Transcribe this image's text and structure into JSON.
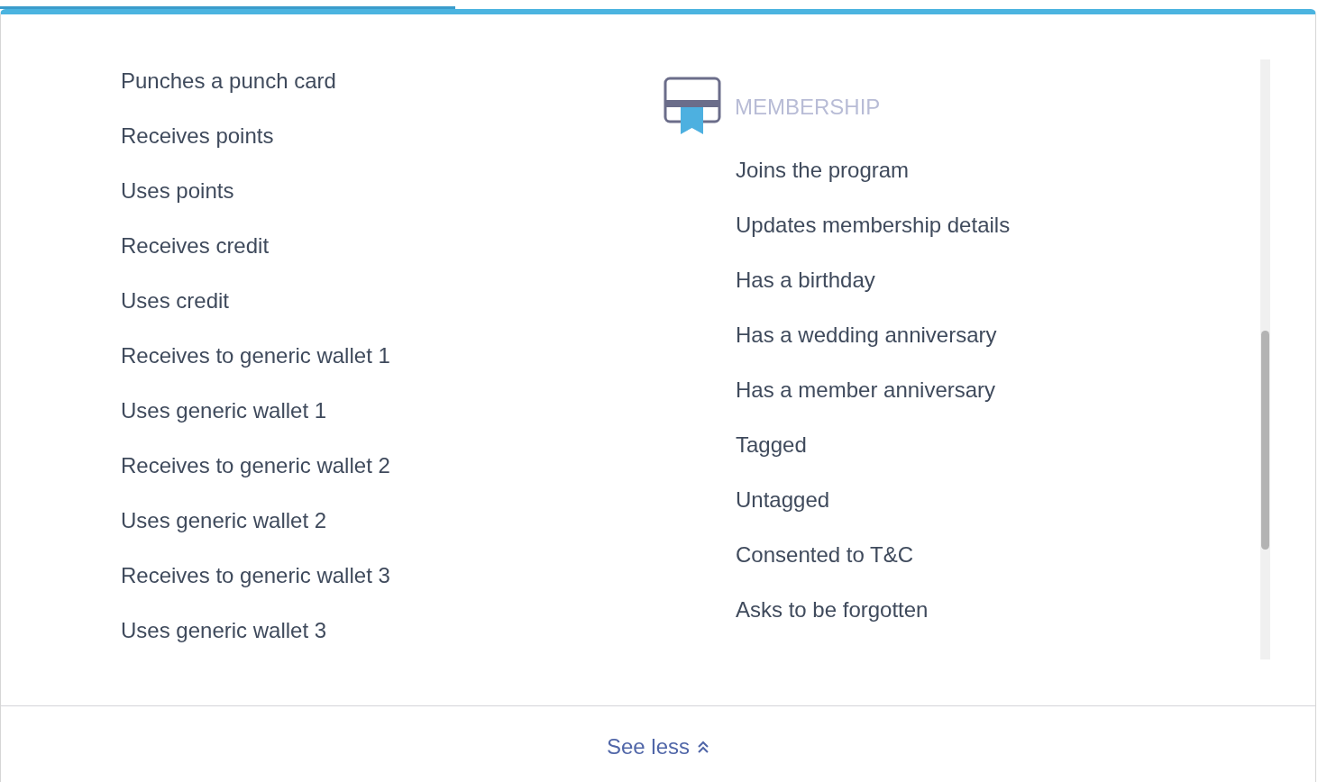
{
  "events_left": [
    "Punches a punch card",
    "Receives points",
    "Uses points",
    "Receives credit",
    "Uses credit",
    "Receives to generic wallet 1",
    "Uses generic wallet 1",
    "Receives to generic wallet 2",
    "Uses generic wallet 2",
    "Receives to generic wallet 3",
    "Uses generic wallet 3"
  ],
  "membership": {
    "title": "MEMBERSHIP",
    "items": [
      "Joins the program",
      "Updates membership details",
      "Has a birthday",
      "Has a wedding anniversary",
      "Has a member anniversary",
      "Tagged",
      "Untagged",
      "Consented to T&C",
      "Asks to be forgotten"
    ]
  },
  "footer": {
    "link": "See less"
  }
}
